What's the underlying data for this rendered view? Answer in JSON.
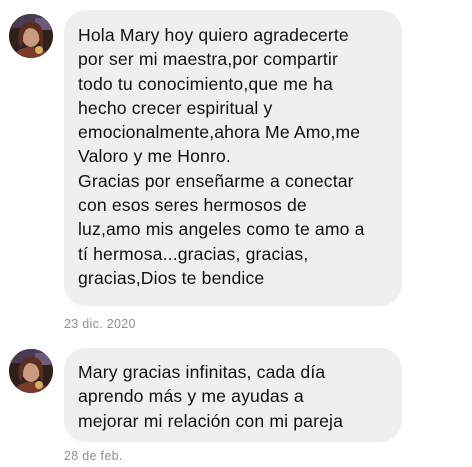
{
  "messages": [
    {
      "text": "Hola Mary hoy quiero agradecerte\npor ser mi maestra,por compartir\ntodo tu conocimiento,que me ha\nhecho crecer espiritual y\nemocionalmente,ahora Me Amo,me\nValoro y me Honro.\n Gracias por enseñarme a conectar\ncon esos seres hermosos de\nluz,amo mis angeles como te amo a\ntí hermosa...gracias, gracias,\ngracias,Dios te bendice",
      "timestamp": "23 dic. 2020"
    },
    {
      "text": "Mary gracias infinitas, cada día\naprendo más y me ayudas a\nmejorar mi relación con mi pareja",
      "timestamp": "28 de feb."
    }
  ],
  "colors": {
    "bubble": "#efefef",
    "text": "#111111",
    "timestamp": "#8e8e8e"
  }
}
